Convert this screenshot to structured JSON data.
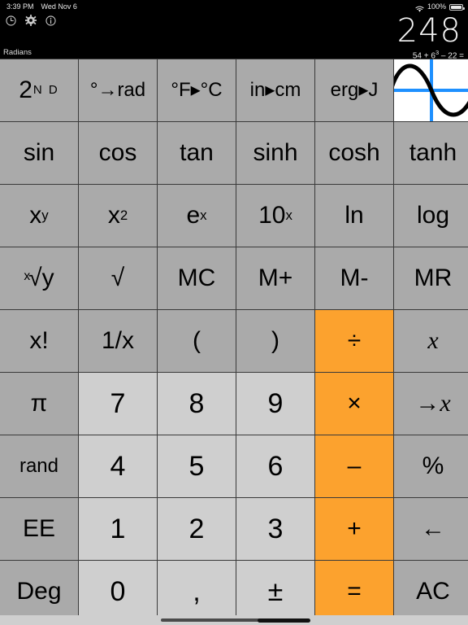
{
  "status_bar": {
    "time": "3:39 PM",
    "date": "Wed Nov 6",
    "wifi_icon": "wifi-icon",
    "battery_percent": "100%",
    "battery_icon": "battery-icon"
  },
  "app_icons": [
    {
      "name": "clock-icon",
      "label": "History"
    },
    {
      "name": "gear-icon",
      "label": "Settings"
    },
    {
      "name": "info-icon",
      "label": "Info"
    }
  ],
  "display": {
    "result": "248",
    "expression": "54 + 6",
    "expression_exponent": "3",
    "expression_tail": " – 22 =",
    "angle_mode": "Radians"
  },
  "colors": {
    "function_key": "#aaaaaa",
    "digit_key": "#cfcfcf",
    "operator_key": "#fca22e",
    "graph_key": "#ffffff",
    "graph_axis": "#1e90ff",
    "grid_line": "#3a3a3a",
    "display_text": "#f2f2f2",
    "background": "#000000"
  },
  "keypad": {
    "columns": 6,
    "rows": 9,
    "keys": [
      {
        "label": "2",
        "sup": "N D",
        "name": "second-function-key",
        "type": "func",
        "style": "nd"
      },
      {
        "label": "°→rad",
        "name": "deg-to-rad-key",
        "type": "func",
        "style": "sm"
      },
      {
        "label": "°F▸°C",
        "name": "fahrenheit-to-celsius-key",
        "type": "func",
        "style": "sm"
      },
      {
        "label": "in▸cm",
        "name": "inch-to-cm-key",
        "type": "func",
        "style": "sm"
      },
      {
        "label": "erg▸J",
        "name": "erg-to-joule-key",
        "type": "func",
        "style": "sm"
      },
      {
        "label": "",
        "name": "graph-icon-key",
        "type": "graph"
      },
      {
        "label": "sin",
        "name": "sin-key",
        "type": "func"
      },
      {
        "label": "cos",
        "name": "cos-key",
        "type": "func"
      },
      {
        "label": "tan",
        "name": "tan-key",
        "type": "func"
      },
      {
        "label": "sinh",
        "name": "sinh-key",
        "type": "func"
      },
      {
        "label": "cosh",
        "name": "cosh-key",
        "type": "func"
      },
      {
        "label": "tanh",
        "name": "tanh-key",
        "type": "func"
      },
      {
        "label": "x",
        "sup": "y",
        "name": "x-to-the-y-key",
        "type": "func"
      },
      {
        "label": "x",
        "sup": "2",
        "name": "x-squared-key",
        "type": "func"
      },
      {
        "label": "e",
        "sup": "x",
        "name": "e-to-the-x-key",
        "type": "func"
      },
      {
        "label": "10",
        "sup": "x",
        "name": "ten-to-the-x-key",
        "type": "func"
      },
      {
        "label": "ln",
        "name": "natural-log-key",
        "type": "func"
      },
      {
        "label": "log",
        "name": "log-key",
        "type": "func"
      },
      {
        "label": "√y",
        "idx": "x",
        "name": "xth-root-of-y-key",
        "type": "root"
      },
      {
        "label": "√",
        "name": "square-root-key",
        "type": "func"
      },
      {
        "label": "MC",
        "name": "memory-clear-key",
        "type": "func"
      },
      {
        "label": "M+",
        "name": "memory-add-key",
        "type": "func"
      },
      {
        "label": "M-",
        "name": "memory-subtract-key",
        "type": "func"
      },
      {
        "label": "MR",
        "name": "memory-recall-key",
        "type": "func"
      },
      {
        "label": "x!",
        "name": "factorial-key",
        "type": "func"
      },
      {
        "label": "1/x",
        "name": "reciprocal-key",
        "type": "func"
      },
      {
        "label": "(",
        "name": "left-paren-key",
        "type": "func"
      },
      {
        "label": ")",
        "name": "right-paren-key",
        "type": "func"
      },
      {
        "label": "÷",
        "name": "divide-key",
        "type": "op"
      },
      {
        "label": "x",
        "name": "variable-x-key",
        "type": "func",
        "style": "ital"
      },
      {
        "label": "π",
        "name": "pi-key",
        "type": "func"
      },
      {
        "label": "7",
        "name": "digit-7-key",
        "type": "num"
      },
      {
        "label": "8",
        "name": "digit-8-key",
        "type": "num"
      },
      {
        "label": "9",
        "name": "digit-9-key",
        "type": "num"
      },
      {
        "label": "×",
        "name": "multiply-key",
        "type": "op"
      },
      {
        "label": "→x",
        "name": "store-to-x-key",
        "type": "func",
        "style": "ital"
      },
      {
        "label": "rand",
        "name": "random-key",
        "type": "func",
        "style": "sm"
      },
      {
        "label": "4",
        "name": "digit-4-key",
        "type": "num"
      },
      {
        "label": "5",
        "name": "digit-5-key",
        "type": "num"
      },
      {
        "label": "6",
        "name": "digit-6-key",
        "type": "num"
      },
      {
        "label": "–",
        "name": "subtract-key",
        "type": "op"
      },
      {
        "label": "%",
        "name": "percent-key",
        "type": "func"
      },
      {
        "label": "EE",
        "name": "exponent-entry-key",
        "type": "func"
      },
      {
        "label": "1",
        "name": "digit-1-key",
        "type": "num"
      },
      {
        "label": "2",
        "name": "digit-2-key",
        "type": "num"
      },
      {
        "label": "3",
        "name": "digit-3-key",
        "type": "num"
      },
      {
        "label": "+",
        "name": "add-key",
        "type": "op"
      },
      {
        "label": "←",
        "name": "backspace-key",
        "type": "func"
      },
      {
        "label": "Deg",
        "name": "degree-mode-key",
        "type": "func"
      },
      {
        "label": "0",
        "name": "digit-0-key",
        "type": "num"
      },
      {
        "label": ",",
        "name": "decimal-separator-key",
        "type": "num"
      },
      {
        "label": "±",
        "name": "plus-minus-key",
        "type": "num"
      },
      {
        "label": "=",
        "name": "equals-key",
        "type": "op"
      },
      {
        "label": "AC",
        "name": "all-clear-key",
        "type": "func"
      }
    ]
  },
  "home_indicator": "home-indicator"
}
